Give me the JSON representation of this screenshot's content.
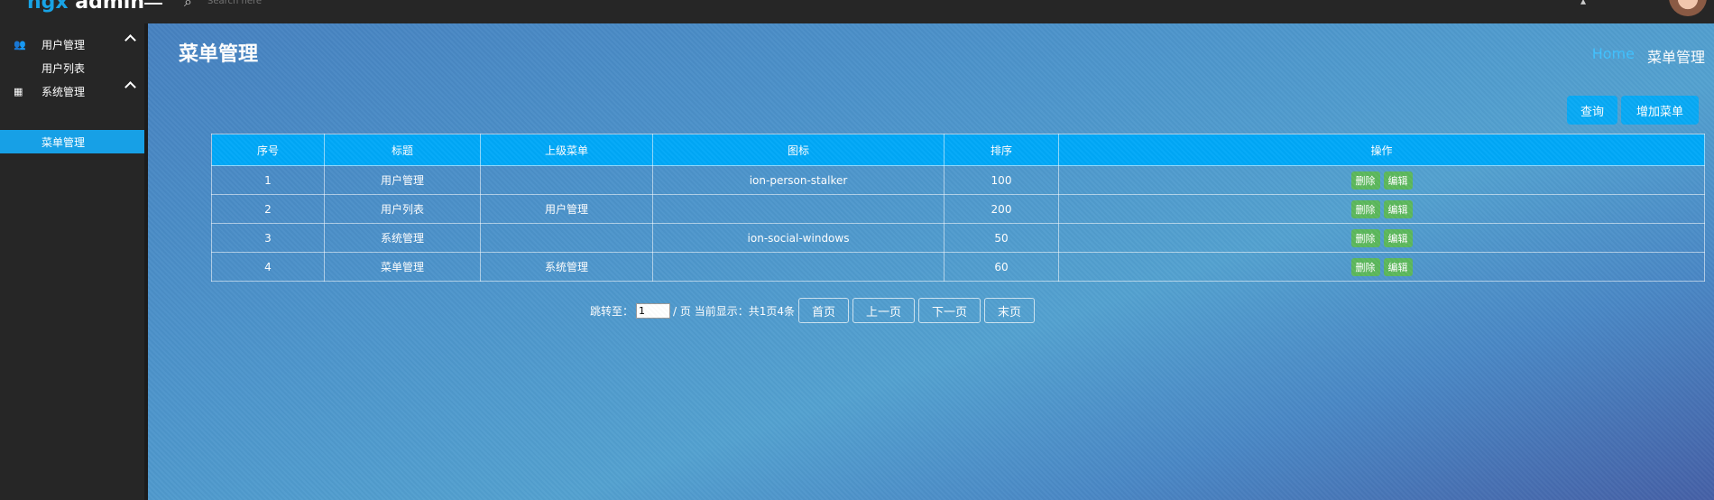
{
  "header": {
    "logo_part1": "ngx",
    "logo_part2": "admin",
    "search_placeholder": "Search here"
  },
  "sidebar": {
    "groups": [
      {
        "label": "用户管理",
        "items": [
          "用户列表"
        ]
      },
      {
        "label": "系统管理",
        "items": [
          "菜单管理"
        ]
      }
    ]
  },
  "page": {
    "title": "菜单管理",
    "breadcrumb_home": "Home",
    "breadcrumb_current": "菜单管理",
    "btn_query": "查询",
    "btn_add": "增加菜单"
  },
  "table": {
    "headers": [
      "序号",
      "标题",
      "上级菜单",
      "图标",
      "排序",
      "操作"
    ],
    "rows": [
      [
        "1",
        "用户管理",
        "",
        "ion-person-stalker",
        "100"
      ],
      [
        "2",
        "用户列表",
        "用户管理",
        "",
        "200"
      ],
      [
        "3",
        "系统管理",
        "",
        "ion-social-windows",
        "50"
      ],
      [
        "4",
        "菜单管理",
        "系统管理",
        "",
        "60"
      ]
    ],
    "delete_label": "删除",
    "edit_label": "编辑"
  },
  "pagination": {
    "jump_label": "跳转至：",
    "page_input_value": "1",
    "status_text": "/ 页 当前显示：共1页4条",
    "first": "首页",
    "prev": "上一页",
    "next": "下一页",
    "last": "末页"
  },
  "colors": {
    "accent": "#00a8f8",
    "sidebar_active": "#17a0e6",
    "op_button": "#5cb85c",
    "breadcrumb_link": "#3fc1ff"
  }
}
